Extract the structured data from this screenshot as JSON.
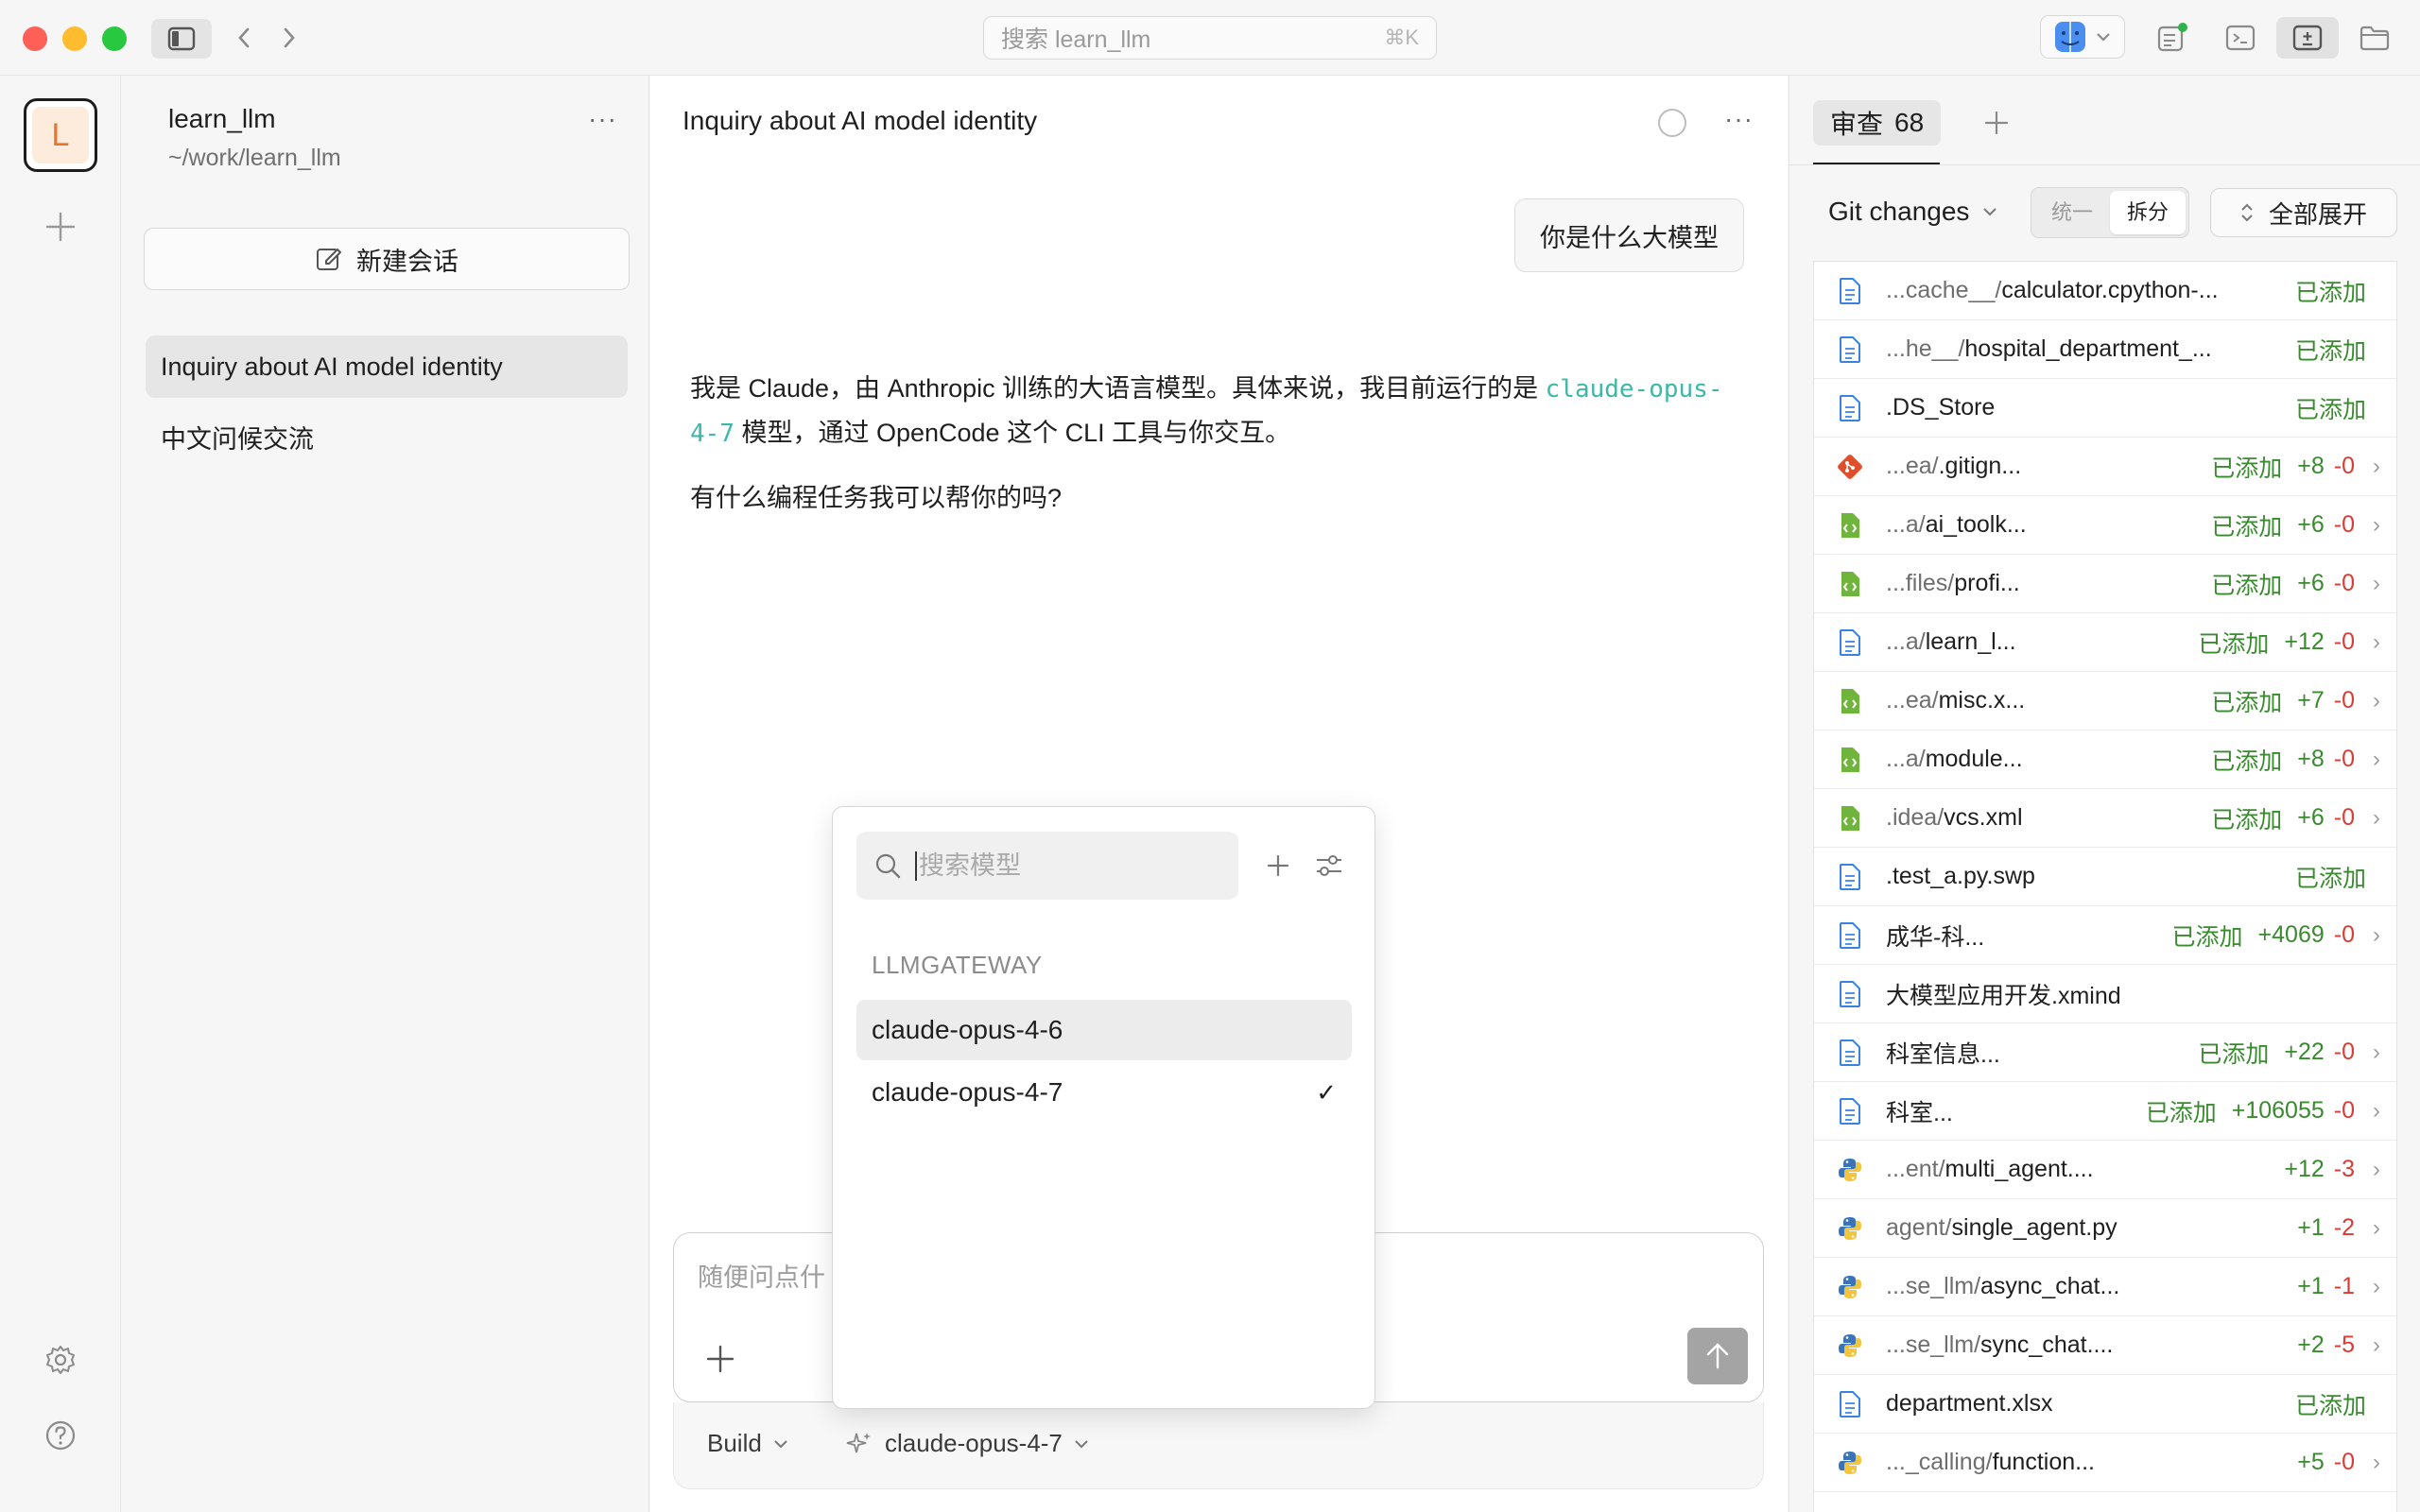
{
  "titlebar": {
    "search_placeholder": "搜索 learn_llm",
    "search_shortcut": "⌘K"
  },
  "rail": {
    "avatar_letter": "L"
  },
  "project": {
    "name": "learn_llm",
    "path": "~/work/learn_llm",
    "more": "···"
  },
  "sessions": {
    "new_chat": "新建会话",
    "items": [
      "Inquiry about AI model identity",
      "中文问候交流"
    ]
  },
  "chat": {
    "title": "Inquiry about AI model identity",
    "user_message": "你是什么大模型",
    "answer_part1": "我是 Claude，由 Anthropic 训练的大语言模型。具体来说，我目前运行的是 ",
    "answer_code": "claude-opus-4-7",
    "answer_part2": " 模型，通过 OpenCode 这个 CLI 工具与你交互。",
    "answer_line2": "有什么编程任务我可以帮你的吗?",
    "composer_placeholder": "随便问点什",
    "mode": "Build",
    "model": "claude-opus-4-7"
  },
  "model_picker": {
    "search_placeholder": "搜索模型",
    "group": "LLMGATEWAY",
    "models": [
      "claude-opus-4-6",
      "claude-opus-4-7"
    ],
    "selected": "claude-opus-4-7",
    "check": "✓"
  },
  "review": {
    "tab_label": "审查",
    "tab_count": "68",
    "git_changes": "Git changes",
    "seg_unified": "统一",
    "seg_split": "拆分",
    "expand_all": "全部展开",
    "files": [
      {
        "dir": "...cache__/",
        "name": "calculator.cpython-...",
        "status": "已添加",
        "plus": "",
        "minus": "",
        "icon": "doc-icon",
        "chevron": false
      },
      {
        "dir": "...he__/",
        "name": "hospital_department_...",
        "status": "已添加",
        "plus": "",
        "minus": "",
        "icon": "doc-icon",
        "chevron": false
      },
      {
        "dir": "",
        "name": ".DS_Store",
        "status": "已添加",
        "plus": "",
        "minus": "",
        "icon": "doc-icon",
        "chevron": false
      },
      {
        "dir": "...ea/",
        "name": ".gitign...",
        "status": "已添加",
        "plus": "+8",
        "minus": "-0",
        "icon": "git-icon",
        "chevron": true
      },
      {
        "dir": "...a/",
        "name": "ai_toolk...",
        "status": "已添加",
        "plus": "+6",
        "minus": "-0",
        "icon": "code-file-icon",
        "chevron": true
      },
      {
        "dir": "...files/",
        "name": "profi...",
        "status": "已添加",
        "plus": "+6",
        "minus": "-0",
        "icon": "code-file-icon",
        "chevron": true
      },
      {
        "dir": "...a/",
        "name": "learn_l...",
        "status": "已添加",
        "plus": "+12",
        "minus": "-0",
        "icon": "doc-icon",
        "chevron": true
      },
      {
        "dir": "...ea/",
        "name": "misc.x...",
        "status": "已添加",
        "plus": "+7",
        "minus": "-0",
        "icon": "code-file-icon",
        "chevron": true
      },
      {
        "dir": "...a/",
        "name": "module...",
        "status": "已添加",
        "plus": "+8",
        "minus": "-0",
        "icon": "code-file-icon",
        "chevron": true
      },
      {
        "dir": ".idea/",
        "name": "vcs.xml",
        "status": "已添加",
        "plus": "+6",
        "minus": "-0",
        "icon": "code-file-icon",
        "chevron": true
      },
      {
        "dir": "",
        "name": ".test_a.py.swp",
        "status": "已添加",
        "plus": "",
        "minus": "",
        "icon": "doc-icon",
        "chevron": false
      },
      {
        "dir": "",
        "name": "成华-科...",
        "status": "已添加",
        "plus": "+4069",
        "minus": "-0",
        "icon": "doc-icon",
        "chevron": true
      },
      {
        "dir": "",
        "name": "大模型应用开发.xmind",
        "status": "",
        "plus": "",
        "minus": "",
        "icon": "doc-icon",
        "chevron": false
      },
      {
        "dir": "",
        "name": "科室信息...",
        "status": "已添加",
        "plus": "+22",
        "minus": "-0",
        "icon": "doc-icon",
        "chevron": true
      },
      {
        "dir": "",
        "name": "科室...",
        "status": "已添加",
        "plus": "+106055",
        "minus": "-0",
        "icon": "doc-icon",
        "chevron": true
      },
      {
        "dir": "...ent/",
        "name": "multi_agent....",
        "status": "",
        "plus": "+12",
        "minus": "-3",
        "icon": "python-icon",
        "chevron": true
      },
      {
        "dir": "agent/",
        "name": "single_agent.py",
        "status": "",
        "plus": "+1",
        "minus": "-2",
        "icon": "python-icon",
        "chevron": true
      },
      {
        "dir": "...se_llm/",
        "name": "async_chat...",
        "status": "",
        "plus": "+1",
        "minus": "-1",
        "icon": "python-icon",
        "chevron": true
      },
      {
        "dir": "...se_llm/",
        "name": "sync_chat....",
        "status": "",
        "plus": "+2",
        "minus": "-5",
        "icon": "python-icon",
        "chevron": true
      },
      {
        "dir": "",
        "name": "department.xlsx",
        "status": "已添加",
        "plus": "",
        "minus": "",
        "icon": "doc-icon",
        "chevron": false
      },
      {
        "dir": "..._calling/",
        "name": "function...",
        "status": "",
        "plus": "+5",
        "minus": "-0",
        "icon": "python-icon",
        "chevron": true
      }
    ]
  },
  "colors": {
    "added": "#3a8a30",
    "removed": "#d83c34",
    "code": "#3db8a8",
    "avatar": "#e5762e"
  }
}
